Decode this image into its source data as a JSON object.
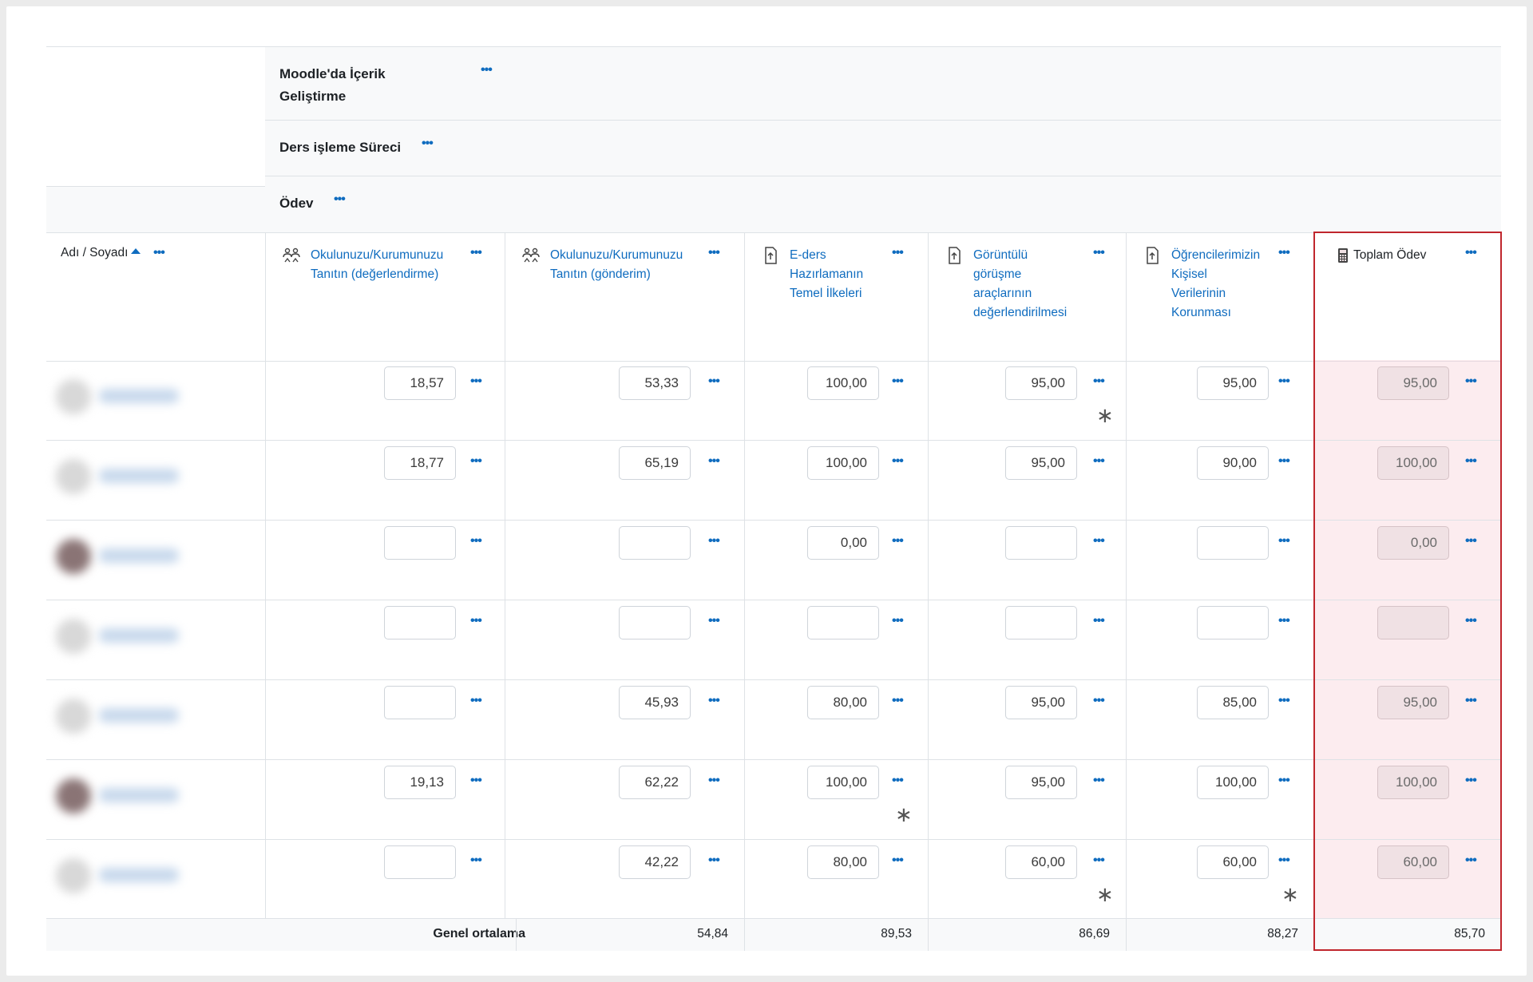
{
  "bands": {
    "category": "Moodle'da İçerik Geliştirme",
    "category_line1": "Moodle'da İçerik",
    "category_line2": "Geliştirme",
    "subcategory": "Ders işleme Süreci",
    "activity_group": "Ödev"
  },
  "menu_glyph": "•••",
  "name_header": "Adı / Soyadı",
  "columns": [
    {
      "title_lines": [
        "Okulunuzu/Kurumunuzu",
        "Tanıtın (değerlendirme)"
      ],
      "icon": "workshop-icon"
    },
    {
      "title_lines": [
        "Okulunuzu/Kurumunuzu",
        "Tanıtın (gönderim)"
      ],
      "icon": "workshop-icon"
    },
    {
      "title_lines": [
        "E-ders",
        "Hazırlamanın",
        "Temel İlkeleri"
      ],
      "icon": "assignment-icon"
    },
    {
      "title_lines": [
        "Görüntülü",
        "görüşme",
        "araçlarının",
        "değerlendirilmesi"
      ],
      "icon": "assignment-icon"
    },
    {
      "title_lines": [
        "Öğrencilerimizin",
        "Kişisel",
        "Verilerinin",
        "Korunması"
      ],
      "icon": "assignment-icon"
    },
    {
      "title_lines": [
        "Toplam Ödev"
      ],
      "icon": "calculator-icon"
    }
  ],
  "rows": [
    {
      "avatar": "light",
      "grades": [
        "18,57",
        "53,33",
        "100,00",
        "95,00",
        "95,00",
        "95,00"
      ],
      "stars": [
        false,
        false,
        false,
        true,
        false,
        false
      ]
    },
    {
      "avatar": "light",
      "grades": [
        "18,77",
        "65,19",
        "100,00",
        "95,00",
        "90,00",
        "100,00"
      ],
      "stars": [
        false,
        false,
        false,
        false,
        false,
        false
      ]
    },
    {
      "avatar": "dark",
      "grades": [
        "",
        "",
        "0,00",
        "",
        "",
        "0,00"
      ],
      "stars": [
        false,
        false,
        false,
        false,
        false,
        false
      ]
    },
    {
      "avatar": "light",
      "grades": [
        "",
        "",
        "",
        "",
        "",
        ""
      ],
      "stars": [
        false,
        false,
        false,
        false,
        false,
        false
      ]
    },
    {
      "avatar": "light",
      "grades": [
        "",
        "45,93",
        "80,00",
        "95,00",
        "85,00",
        "95,00"
      ],
      "stars": [
        false,
        false,
        false,
        false,
        false,
        false
      ]
    },
    {
      "avatar": "dark",
      "grades": [
        "19,13",
        "62,22",
        "100,00",
        "95,00",
        "100,00",
        "100,00"
      ],
      "stars": [
        false,
        false,
        true,
        false,
        false,
        false
      ]
    },
    {
      "avatar": "light",
      "grades": [
        "",
        "42,22",
        "80,00",
        "60,00",
        "60,00",
        "60,00"
      ],
      "stars": [
        false,
        false,
        false,
        true,
        true,
        false
      ]
    }
  ],
  "footer": {
    "label": "Genel ortalama",
    "averages": [
      "",
      "54,84",
      "89,53",
      "86,69",
      "88,27",
      "85,70"
    ]
  },
  "star_glyph": "∗",
  "colors": {
    "link": "#0f6cbf",
    "highlight_border": "#c0262d"
  }
}
